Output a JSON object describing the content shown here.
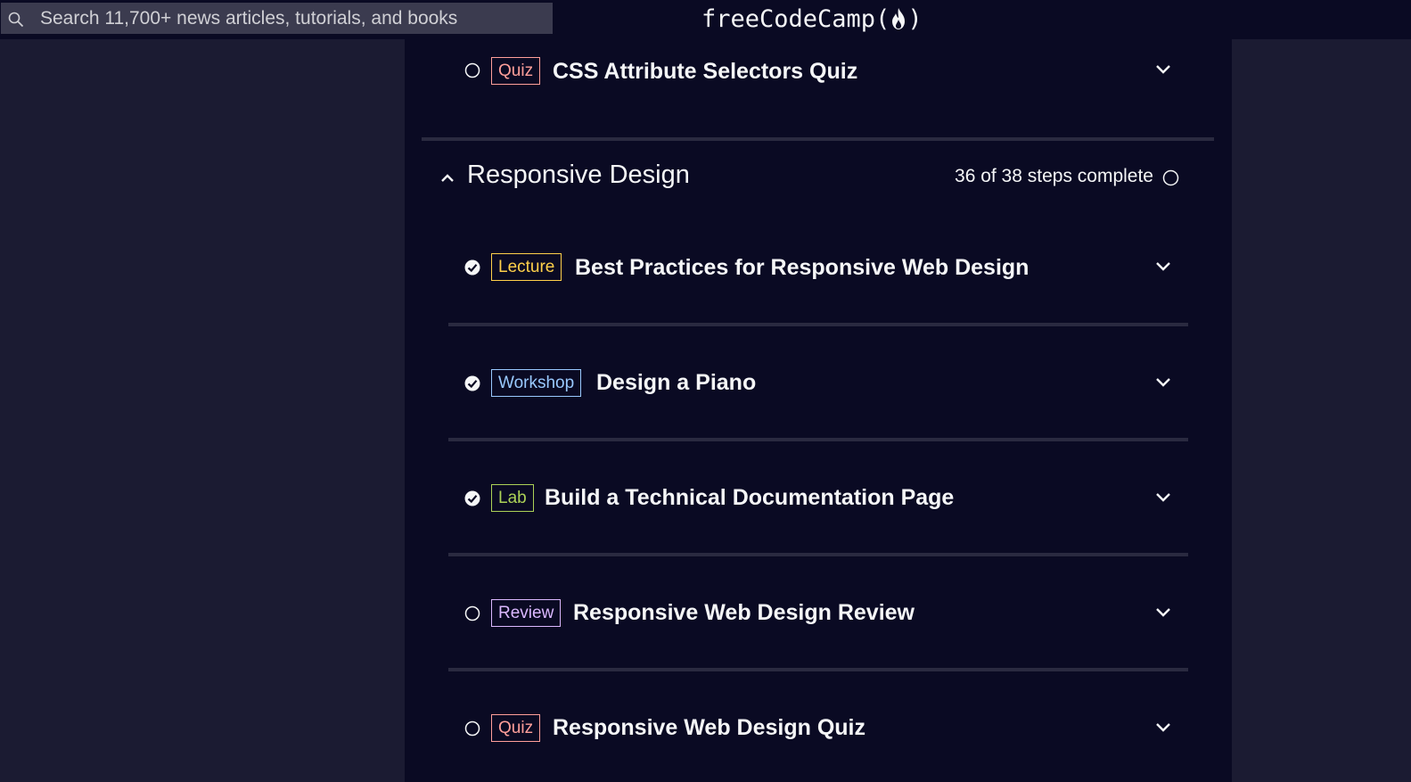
{
  "search": {
    "placeholder": "Search 11,700+ news articles, tutorials, and books"
  },
  "logo": {
    "text": "freeCodeCamp"
  },
  "colors": {
    "quiz": "#ff9f9a",
    "lecture": "#ffd04a",
    "workshop": "#99c9ff",
    "lab": "#acd157",
    "review": "#dbb8ff"
  },
  "prev_item": {
    "badge": "Quiz",
    "title": "CSS Attribute Selectors Quiz",
    "completed": false
  },
  "section": {
    "title": "Responsive Design",
    "progress": "36 of 38 steps complete",
    "items": [
      {
        "badge": "Lecture",
        "title": "Best Practices for Responsive Web Design",
        "completed": true
      },
      {
        "badge": "Workshop",
        "title": "Design a Piano",
        "completed": true
      },
      {
        "badge": "Lab",
        "title": "Build a Technical Documentation Page",
        "completed": true
      },
      {
        "badge": "Review",
        "title": "Responsive Web Design Review",
        "completed": false
      },
      {
        "badge": "Quiz",
        "title": "Responsive Web Design Quiz",
        "completed": false
      }
    ]
  }
}
